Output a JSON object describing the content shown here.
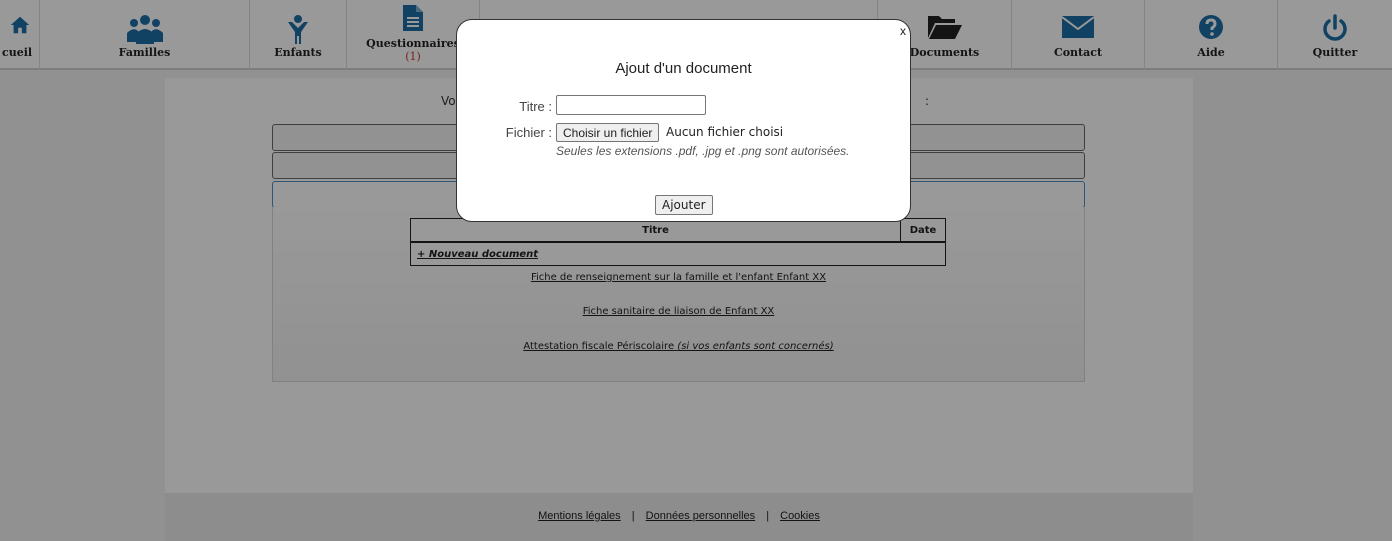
{
  "nav": {
    "accueil": "cueil",
    "familles": "Familles",
    "enfants": "Enfants",
    "questionnaires": "Questionnaires",
    "questionnaires_count": "(1)",
    "documents": "Documents",
    "contact": "Contact",
    "aide": "Aide",
    "quitter": "Quitter"
  },
  "colors": {
    "nav_icon": "#1d6fa5",
    "icon_dark": "#222222",
    "badge": "#c0392b",
    "accordion_open_border": "#4a90c8"
  },
  "content": {
    "intro_left": "Vo",
    "intro_right": ":"
  },
  "table": {
    "columns": [
      "Titre",
      "Date"
    ],
    "new_document_link": "+ Nouveau document"
  },
  "links": {
    "fiche_renseignement": "Fiche de renseignement sur la famille et l'enfant Enfant XX",
    "fiche_sanitaire": "Fiche sanitaire de liaison de Enfant XX",
    "attestation": "Attestation fiscale Périscolaire",
    "attestation_note": "(si vos enfants sont concernés)"
  },
  "footer": {
    "mentions": "Mentions légales",
    "sep": "|",
    "donnees": "Données personnelles",
    "cookies": "Cookies"
  },
  "modal": {
    "close": "x",
    "title": "Ajout d'un document",
    "titre_label": "Titre :",
    "titre_value": "",
    "fichier_label": "Fichier :",
    "file_button": "Choisir un fichier",
    "file_status": "Aucun fichier choisi",
    "hint": "Seules les extensions .pdf, .jpg et .png sont autorisées.",
    "submit": "Ajouter"
  },
  "icons": {
    "accueil": "house-icon",
    "familles": "family-group-icon",
    "enfants": "child-icon",
    "questionnaires": "document-form-icon",
    "documents": "folder-open-icon",
    "contact": "envelope-icon",
    "aide": "question-circle-icon",
    "quitter": "power-icon"
  }
}
